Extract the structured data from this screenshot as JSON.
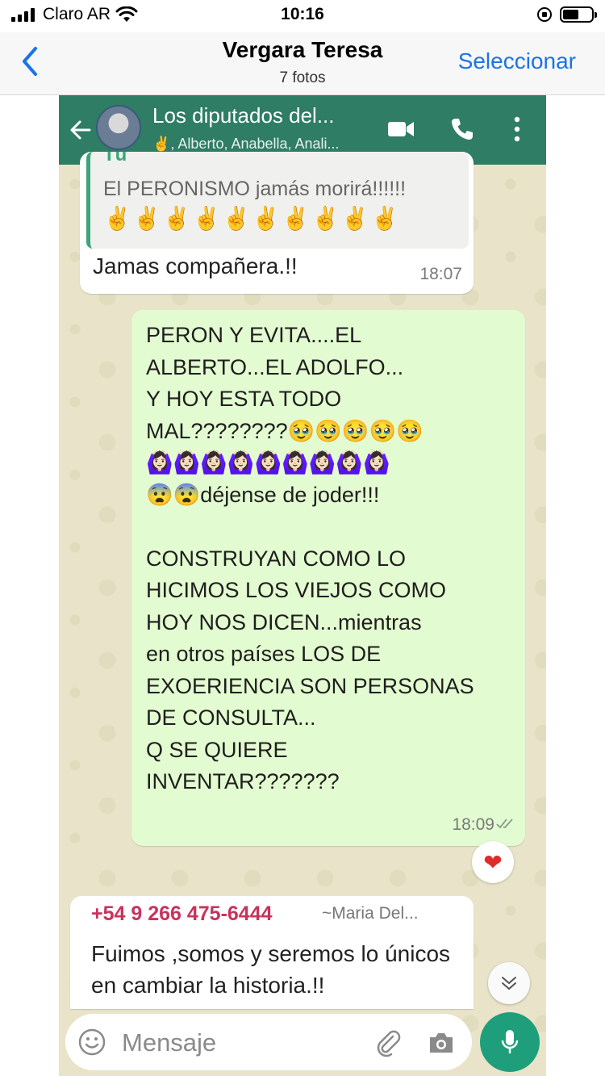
{
  "status_bar": {
    "carrier": "Claro AR",
    "time": "10:16"
  },
  "nav": {
    "back_icon": "chevron-left-icon",
    "title": "Vergara Teresa",
    "subtitle": "7 fotos",
    "select_label": "Seleccionar",
    "accent_color": "#1a73e8"
  },
  "chat": {
    "header": {
      "title": "Los diputados del...",
      "members": "✌️, Alberto, Anabella, Anali...",
      "color": "#2e7d64"
    },
    "messages": [
      {
        "quoted_author": "Tú",
        "quoted_text": "El PERONISMO jamás morirá!!!!!!",
        "quoted_emoji": "✌️✌️✌️✌️✌️✌️✌️✌️✌️✌️",
        "text": "Jamas compañera.!!",
        "time": "18:07"
      },
      {
        "text": "PERON Y EVITA....EL\nALBERTO...EL ADOLFO...\nY HOY ESTA TODO\nMAL????????🥹🥹🥹🥹🥹\n🙆🏻‍♀️🙆🏻‍♀️🙆🏻‍♀️🙆🏻‍♀️🙆🏻‍♀️🙆🏻‍♀️🙆🏻‍♀️🙆🏻‍♀️🙆🏻‍♀️\n😨😨déjense de joder!!!\n\nCONSTRUYAN COMO LO\nHICIMOS LOS VIEJOS COMO\nHOY NOS DICEN...mientras\nen otros países LOS DE\nEXOERIENCIA SON PERSONAS\nDE CONSULTA...\nQ SE QUIERE\nINVENTAR???????",
        "time": "18:09",
        "reaction": "❤"
      },
      {
        "sender_phone": "+54 9 266 475-6444",
        "sender_name": "~Maria Del...",
        "text": "Fuimos ,somos y seremos lo únicos en cambiar la historia.!!"
      }
    ],
    "input": {
      "placeholder": "Mensaje"
    }
  }
}
